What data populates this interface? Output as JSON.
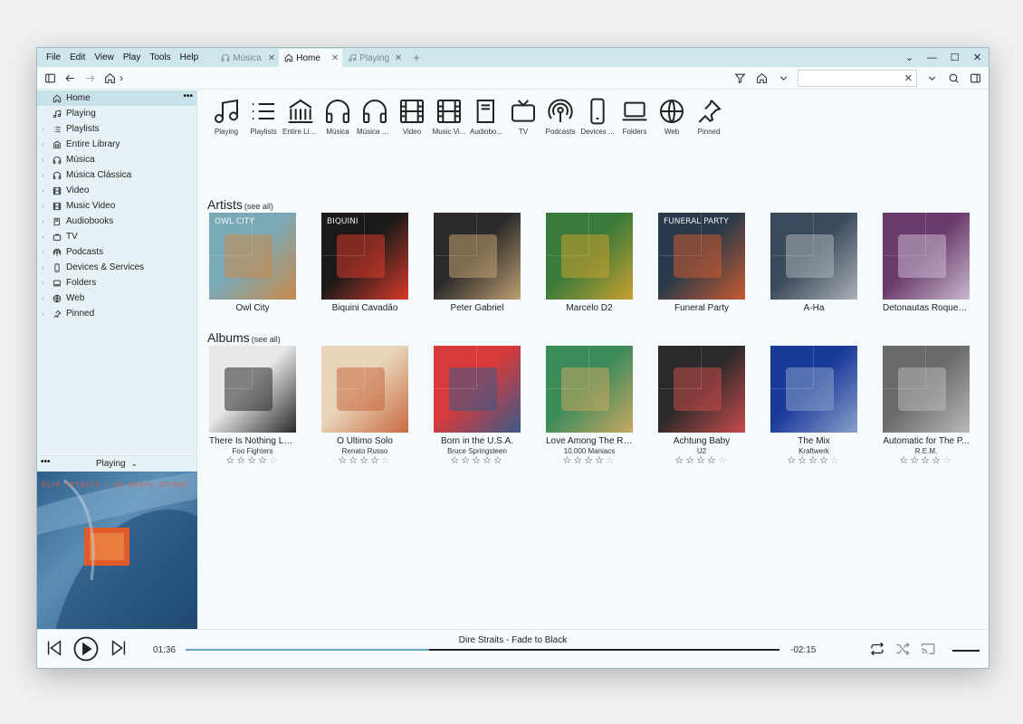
{
  "menu": [
    "File",
    "Edit",
    "View",
    "Play",
    "Tools",
    "Help"
  ],
  "tabs": [
    {
      "label": "Música",
      "icon": "headphones-icon",
      "active": false
    },
    {
      "label": "Home",
      "icon": "home-icon",
      "active": true
    },
    {
      "label": "Playing",
      "icon": "music-note-icon",
      "active": false
    }
  ],
  "search": {
    "value": "",
    "placeholder": ""
  },
  "sidebar": {
    "items": [
      {
        "label": "Home",
        "icon": "home-icon",
        "selected": true
      },
      {
        "label": "Playing",
        "icon": "music-note-icon"
      },
      {
        "label": "Playlists",
        "icon": "list-icon"
      },
      {
        "label": "Entire Library",
        "icon": "library-icon"
      },
      {
        "label": "Música",
        "icon": "headphones-icon"
      },
      {
        "label": "Música Clássica",
        "icon": "headphones-icon"
      },
      {
        "label": "Video",
        "icon": "film-icon"
      },
      {
        "label": "Music Video",
        "icon": "film-icon"
      },
      {
        "label": "Audiobooks",
        "icon": "book-icon"
      },
      {
        "label": "TV",
        "icon": "tv-icon"
      },
      {
        "label": "Podcasts",
        "icon": "podcast-icon"
      },
      {
        "label": "Devices & Services",
        "icon": "device-icon"
      },
      {
        "label": "Folders",
        "icon": "laptop-icon"
      },
      {
        "label": "Web",
        "icon": "globe-icon"
      },
      {
        "label": "Pinned",
        "icon": "pin-icon"
      }
    ]
  },
  "nowplaying_pane": {
    "label": "Playing"
  },
  "quickbar": [
    {
      "label": "Playing",
      "icon": "music-note-icon"
    },
    {
      "label": "Playlists",
      "icon": "list-icon"
    },
    {
      "label": "Entire Lib...",
      "icon": "library-icon"
    },
    {
      "label": "Música",
      "icon": "headphones-icon"
    },
    {
      "label": "Música Cl...",
      "icon": "headphones-icon"
    },
    {
      "label": "Video",
      "icon": "film-icon"
    },
    {
      "label": "Music Vi...",
      "icon": "film-icon"
    },
    {
      "label": "Audiobo...",
      "icon": "book-icon"
    },
    {
      "label": "TV",
      "icon": "tv-icon"
    },
    {
      "label": "Podcasts",
      "icon": "podcast-icon"
    },
    {
      "label": "Devices ...",
      "icon": "device-icon"
    },
    {
      "label": "Folders",
      "icon": "laptop-icon"
    },
    {
      "label": "Web",
      "icon": "globe-icon"
    },
    {
      "label": "Pinned",
      "icon": "pin-icon"
    }
  ],
  "artists": {
    "title": "Artists",
    "see_all": "(see all)",
    "items": [
      {
        "name": "Owl City",
        "cover_text": "OWL CITY",
        "colors": [
          "#7aa9b8",
          "#c88a4a"
        ]
      },
      {
        "name": "Biquini Cavadão",
        "cover_text": "BIQUINI",
        "colors": [
          "#1a1a1a",
          "#d83a2a"
        ]
      },
      {
        "name": "Peter Gabriel",
        "cover_text": "",
        "colors": [
          "#2a2a2a",
          "#c0a070"
        ]
      },
      {
        "name": "Marcelo D2",
        "cover_text": "",
        "colors": [
          "#3a7a3a",
          "#c8a030"
        ]
      },
      {
        "name": "Funeral Party",
        "cover_text": "FUNERAL PARTY",
        "colors": [
          "#2a3a4a",
          "#c85a30"
        ]
      },
      {
        "name": "A-Ha",
        "cover_text": "",
        "colors": [
          "#3a4a5a",
          "#aab0b8"
        ]
      },
      {
        "name": "Detonautas Roque C...",
        "cover_text": "",
        "colors": [
          "#6a3a6a",
          "#c8b8d0"
        ]
      }
    ]
  },
  "albums": {
    "title": "Albums",
    "see_all": "(see all)",
    "items": [
      {
        "name": "There Is Nothing Lef...",
        "artist": "Foo Fighters",
        "rating": 3.5,
        "colors": [
          "#e8e8e8",
          "#2a2a2a"
        ]
      },
      {
        "name": "O Último Solo",
        "artist": "Renato Russo",
        "rating": 4,
        "colors": [
          "#e8d4b8",
          "#c86a40"
        ]
      },
      {
        "name": "Born in the U.S.A.",
        "artist": "Bruce Springsteen",
        "rating": 4.5,
        "colors": [
          "#d83a3a",
          "#3a5a8a"
        ]
      },
      {
        "name": "Love Among The Rui...",
        "artist": "10.000 Maniacs",
        "rating": 3.5,
        "colors": [
          "#3a8a5a",
          "#c8a860"
        ]
      },
      {
        "name": "Achtung Baby",
        "artist": "U2",
        "rating": 4,
        "colors": [
          "#2a2a2a",
          "#c84a4a"
        ]
      },
      {
        "name": "The Mix",
        "artist": "Kraftwerk",
        "rating": 4,
        "colors": [
          "#1a3a9a",
          "#8aa0c8"
        ]
      },
      {
        "name": "Automatic for The P...",
        "artist": "R.E.M.",
        "rating": 3.5,
        "colors": [
          "#6a6a6a",
          "#b8b8b8"
        ]
      }
    ]
  },
  "player": {
    "title": "Dire Straits - Fade to Black",
    "elapsed": "01:36",
    "remaining": "-02:15",
    "progress": 0.41
  }
}
